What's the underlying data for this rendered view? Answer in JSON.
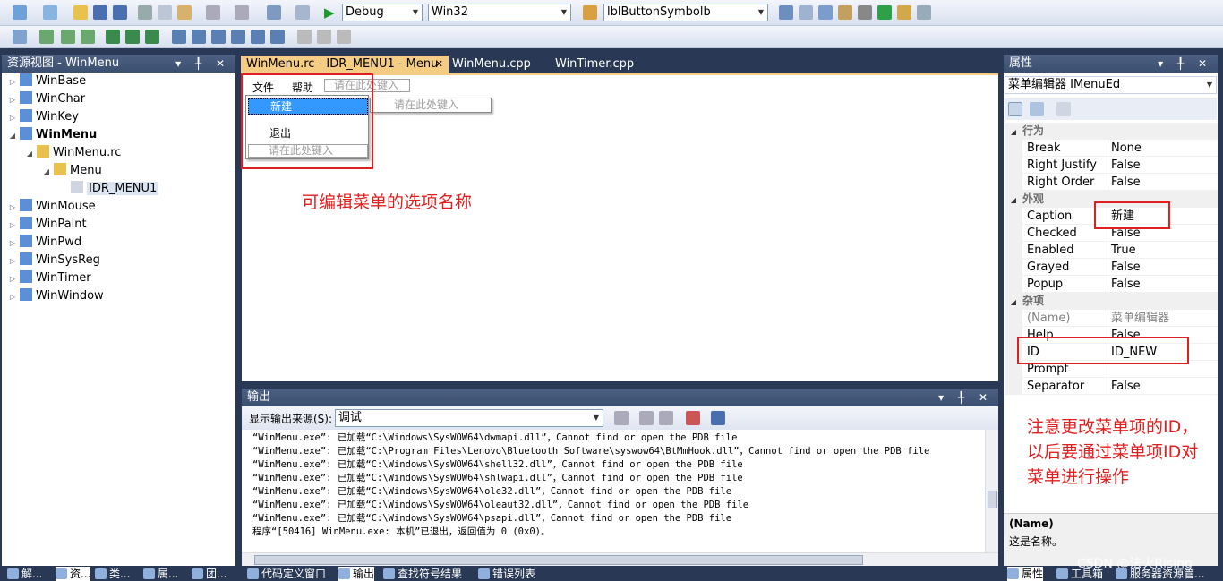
{
  "toolbar": {
    "config_combo": "Debug",
    "platform_combo": "Win32",
    "find_combo": "lblButtonSymbolb"
  },
  "resource_view": {
    "title": "资源视图 - WinMenu",
    "items": [
      {
        "label": "WinBase",
        "bold": false
      },
      {
        "label": "WinChar",
        "bold": false
      },
      {
        "label": "WinKey",
        "bold": false
      },
      {
        "label": "WinMenu",
        "bold": true
      },
      {
        "label": "WinMenu.rc",
        "bold": false
      },
      {
        "label": "Menu",
        "bold": false
      },
      {
        "label": "IDR_MENU1",
        "bold": false
      },
      {
        "label": "WinMouse",
        "bold": false
      },
      {
        "label": "WinPaint",
        "bold": false
      },
      {
        "label": "WinPwd",
        "bold": false
      },
      {
        "label": "WinSysReg",
        "bold": false
      },
      {
        "label": "WinTimer",
        "bold": false
      },
      {
        "label": "WinWindow",
        "bold": false
      }
    ]
  },
  "editor": {
    "tabs": [
      {
        "label": "WinMenu.rc - IDR_MENU1 - Menu",
        "active": true
      },
      {
        "label": "WinMenu.cpp",
        "active": false
      },
      {
        "label": "WinTimer.cpp",
        "active": false
      }
    ],
    "menubar": [
      "文件",
      "帮助"
    ],
    "type_here": "请在此处键入",
    "dropdown": [
      "新建",
      "退出"
    ]
  },
  "annotations": {
    "editable": "可编辑菜单的选项名称",
    "id_note": [
      "注意更改菜单项的ID，",
      "以后要通过菜单项ID对",
      "菜单进行操作"
    ]
  },
  "output": {
    "title": "输出",
    "source_label": "显示输出来源(S):",
    "source_value": "调试",
    "lines": [
      "“WinMenu.exe”: 已加载“C:\\Windows\\SysWOW64\\dwmapi.dll”，Cannot find or open the PDB file",
      "“WinMenu.exe”: 已加载“C:\\Program Files\\Lenovo\\Bluetooth Software\\syswow64\\BtMmHook.dll”，Cannot find or open the PDB file",
      "“WinMenu.exe”: 已加载“C:\\Windows\\SysWOW64\\shell32.dll”，Cannot find or open the PDB file",
      "“WinMenu.exe”: 已加载“C:\\Windows\\SysWOW64\\shlwapi.dll”，Cannot find or open the PDB file",
      "“WinMenu.exe”: 已加载“C:\\Windows\\SysWOW64\\ole32.dll”，Cannot find or open the PDB file",
      "“WinMenu.exe”: 已加载“C:\\Windows\\SysWOW64\\oleaut32.dll”，Cannot find or open the PDB file",
      "“WinMenu.exe”: 已加载“C:\\Windows\\SysWOW64\\psapi.dll”，Cannot find or open the PDB file",
      "程序“[50416] WinMenu.exe: 本机”已退出，返回值为 0 (0x0)。"
    ]
  },
  "properties": {
    "title": "属性",
    "object": "菜单编辑器 IMenuEd",
    "groups": [
      {
        "name": "行为",
        "props": [
          [
            "Break",
            "None"
          ],
          [
            "Right Justify",
            "False"
          ],
          [
            "Right Order",
            "False"
          ]
        ]
      },
      {
        "name": "外观",
        "props": [
          [
            "Caption",
            "新建"
          ],
          [
            "Checked",
            "False"
          ],
          [
            "Enabled",
            "True"
          ],
          [
            "Grayed",
            "False"
          ],
          [
            "Popup",
            "False"
          ]
        ]
      },
      {
        "name": "杂项",
        "props": [
          [
            "(Name)",
            "菜单编辑器"
          ],
          [
            "Help",
            "False"
          ],
          [
            "ID",
            "ID_NEW"
          ],
          [
            "Prompt",
            ""
          ],
          [
            "Separator",
            "False"
          ]
        ]
      }
    ],
    "desc_title": "(Name)",
    "desc_text": "这是名称。"
  },
  "bottom_tabs_left": [
    "解...",
    "资...",
    "类...",
    "属...",
    "团..."
  ],
  "bottom_tabs_mid": [
    "代码定义窗口",
    "输出",
    "查找符号结果",
    "错误列表"
  ],
  "bottom_tabs_right": [
    "属性",
    "工具箱",
    "服务器资源管..."
  ],
  "watermark": "CSDN @法火Rising",
  "colors": {
    "accent": "#e02020",
    "titlebar": "#3b4f70",
    "highlight": "#3399ff"
  }
}
